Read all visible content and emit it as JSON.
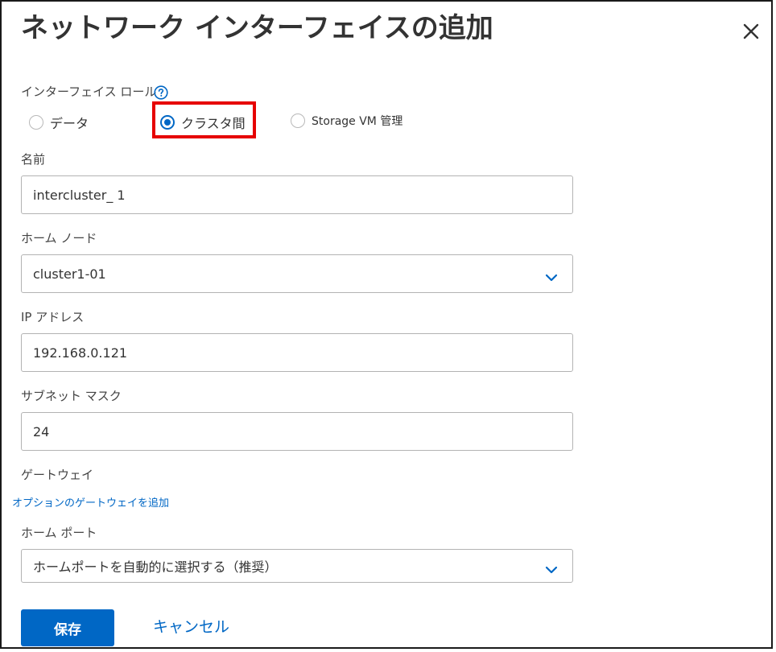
{
  "dialog": {
    "title": "ネットワーク インターフェイスの追加",
    "close_icon": "close-icon"
  },
  "interface_role": {
    "label": "インターフェイス ロール",
    "help_icon": "help-circle-icon",
    "options": [
      {
        "label": "データ",
        "selected": false
      },
      {
        "label": "クラスタ間",
        "selected": true
      },
      {
        "label": "Storage VM 管理",
        "selected": false
      }
    ]
  },
  "name": {
    "label": "名前",
    "value": "intercluster_ 1"
  },
  "home_node": {
    "label": "ホーム ノード",
    "value": "cluster1-01",
    "chevron_icon": "chevron-down-icon"
  },
  "ip_address": {
    "label": "IP アドレス",
    "value": "192.168.0.121"
  },
  "subnet_mask": {
    "label": "サブネット マスク",
    "value": "24"
  },
  "gateway": {
    "label": "ゲートウェイ",
    "add_link": "オプションのゲートウェイを追加"
  },
  "home_port": {
    "label": "ホーム ポート",
    "value": "ホームポートを自動的に選択する（推奨）",
    "chevron_icon": "chevron-down-icon"
  },
  "actions": {
    "save_label": "保存",
    "cancel_label": "キャンセル"
  },
  "colors": {
    "accent": "#0067c5",
    "highlight": "#e60000"
  }
}
